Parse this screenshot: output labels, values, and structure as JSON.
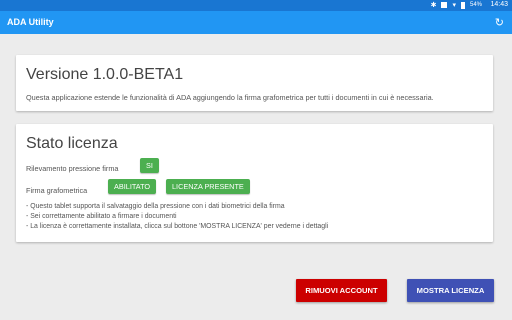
{
  "status_bar": {
    "time": "14:43",
    "battery": "54%"
  },
  "app_bar": {
    "title": "ADA Utility"
  },
  "version_card": {
    "title": "Versione 1.0.0-BETA1",
    "description": "Questa applicazione estende le funzionalità di ADA aggiungendo la firma grafometrica per tutti i documenti in cui è necessaria."
  },
  "license_card": {
    "title": "Stato licenza",
    "pressure_label": "Rilevamento pressione firma",
    "pressure_value": "SI",
    "signature_label": "Firma grafometrica",
    "enabled_badge": "ABILITATO",
    "license_badge": "LICENZA PRESENTE",
    "notes": [
      "- Questo tablet supporta il salvataggio della pressione con i dati biometrici della firma",
      "- Sei correttamente abilitato a firmare i documenti",
      "- La licenza è correttamente installata, clicca sul bottone 'MOSTRA LICENZA' per vederne i dettagli"
    ]
  },
  "actions": {
    "remove_account": "RIMUOVI ACCOUNT",
    "show_license": "MOSTRA LICENZA"
  }
}
